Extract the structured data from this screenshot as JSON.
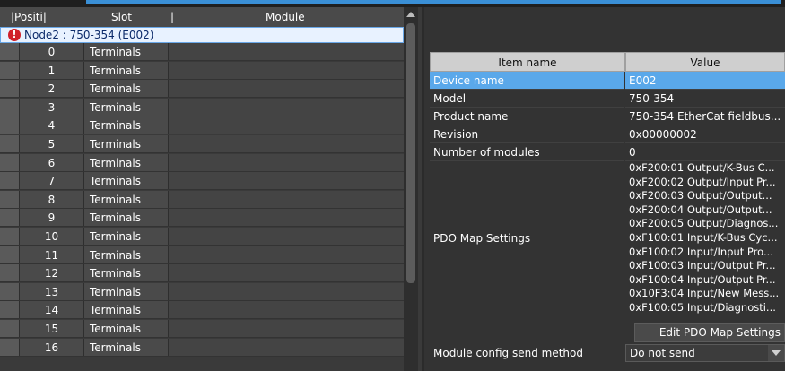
{
  "left_table": {
    "headers": [
      "|Positi|",
      "Slot",
      "|",
      "Module"
    ],
    "node_label": "Node2 : 750-354 (E002)",
    "rows": [
      {
        "pos": "0",
        "slot": "Terminals"
      },
      {
        "pos": "1",
        "slot": "Terminals"
      },
      {
        "pos": "2",
        "slot": "Terminals"
      },
      {
        "pos": "3",
        "slot": "Terminals"
      },
      {
        "pos": "4",
        "slot": "Terminals"
      },
      {
        "pos": "5",
        "slot": "Terminals"
      },
      {
        "pos": "6",
        "slot": "Terminals"
      },
      {
        "pos": "7",
        "slot": "Terminals"
      },
      {
        "pos": "8",
        "slot": "Terminals"
      },
      {
        "pos": "9",
        "slot": "Terminals"
      },
      {
        "pos": "10",
        "slot": "Terminals"
      },
      {
        "pos": "11",
        "slot": "Terminals"
      },
      {
        "pos": "12",
        "slot": "Terminals"
      },
      {
        "pos": "13",
        "slot": "Terminals"
      },
      {
        "pos": "14",
        "slot": "Terminals"
      },
      {
        "pos": "15",
        "slot": "Terminals"
      },
      {
        "pos": "16",
        "slot": "Terminals"
      }
    ]
  },
  "properties": {
    "headers": [
      "Item name",
      "Value"
    ],
    "rows": [
      {
        "name": "Device name",
        "value": "E002",
        "selected": true
      },
      {
        "name": "Model",
        "value": "750-354"
      },
      {
        "name": "Product name",
        "value": "750-354 EtherCat fieldbus..."
      },
      {
        "name": "Revision",
        "value": "0x00000002"
      },
      {
        "name": "Number of modules",
        "value": "0"
      }
    ],
    "pdo_label": "PDO Map Settings",
    "pdo_entries": [
      "0xF200:01 Output/K-Bus C...",
      "0xF200:02 Output/Input Pr...",
      "0xF200:03 Output/Output...",
      "0xF200:04 Output/Output...",
      "0xF200:05 Output/Diagnos...",
      "0xF100:01 Input/K-Bus Cyc...",
      "0xF100:02 Input/Input Pro...",
      "0xF100:03 Input/Output Pr...",
      "0xF100:04 Input/Output Pr...",
      "0x10F3:04 Input/New Mess...",
      "0xF100:05 Input/Diagnosti..."
    ],
    "edit_button": "Edit PDO Map Settings",
    "send_method_label": "Module config send method",
    "send_method_value": "Do not send"
  },
  "colors": {
    "selected_row": "#5aa8ea",
    "node_row": "#e8f2ff",
    "error_icon": "#d0202a"
  }
}
